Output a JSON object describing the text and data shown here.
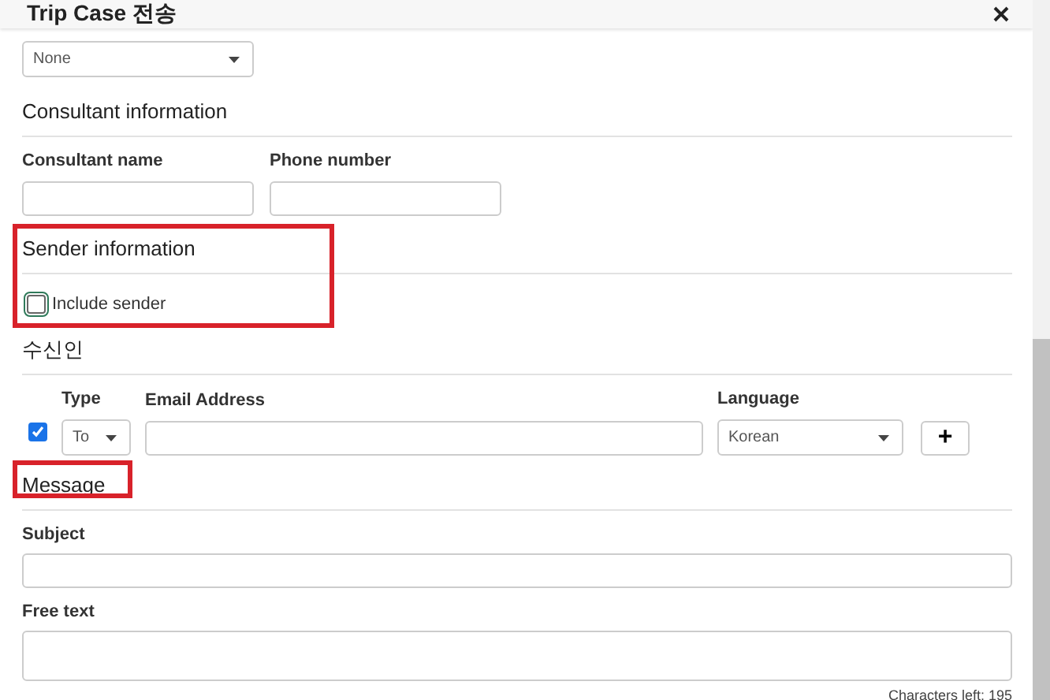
{
  "window": {
    "title": "Trip Case 전송"
  },
  "fee_type": {
    "value": "None"
  },
  "consultant": {
    "heading": "Consultant information",
    "fields": [
      {
        "label": "Consultant name"
      },
      {
        "label": "Phone number"
      }
    ]
  },
  "sender": {
    "heading": "Sender information",
    "highlighted": true,
    "include_label": "Include sender",
    "checked": false
  },
  "recipients": {
    "heading": "수신인",
    "columns": [
      "Type",
      "Email Address",
      "Language"
    ],
    "rows": [
      {
        "checked": true,
        "type": "To",
        "language": "Korean"
      }
    ],
    "add_button": "+"
  },
  "message": {
    "heading": "Message",
    "highlighted": true,
    "subject_label": "Subject",
    "free_text_label": "Free text",
    "characters_left": "Characters left: 195"
  }
}
